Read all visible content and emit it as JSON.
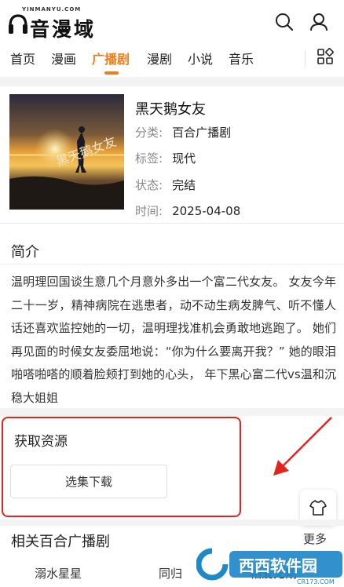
{
  "header": {
    "logo_text": "音漫域",
    "logo_subtitle": "YINMANYU.COM",
    "nav": [
      {
        "label": "首页"
      },
      {
        "label": "漫画"
      },
      {
        "label": "广播剧"
      },
      {
        "label": "漫剧"
      },
      {
        "label": "小说"
      },
      {
        "label": "音乐"
      }
    ],
    "active_index": 2,
    "icons": {
      "search": "search-icon",
      "user": "user-icon",
      "grid": "grid-menu-icon"
    }
  },
  "detail": {
    "title": "黑天鹅女友",
    "cover_text": "黑天鹅女友",
    "meta": [
      {
        "key": "分类:",
        "value": "百合广播剧"
      },
      {
        "key": "标签:",
        "value": "现代"
      },
      {
        "key": "状态:",
        "value": "完结"
      },
      {
        "key": "时间:",
        "value": "2025-04-08"
      }
    ]
  },
  "intro": {
    "heading": "简介",
    "text": "温明理回国谈生意几个月意外多出一个富二代女友。 女友今年二十一岁，精神病院在逃患者，动不动生病发脾气、听不懂人话还喜欢监控她的一切，温明理找准机会勇敢地逃跑了。 她们再见面的时候女友委屈地说：“你为什么要离开我？” 她的眼泪啪嗒啪嗒的顺着脸颊打到她的心头， 年下黑心富二代vs温和沉稳大姐姐"
  },
  "resources": {
    "heading": "获取资源",
    "button_label": "选集下载"
  },
  "related": {
    "heading": "相关百合广播剧",
    "more_label": "更多",
    "items": [
      "溺水星星",
      "同归",
      "相爱无期"
    ]
  },
  "watermark": {
    "text": "西西软件园",
    "sub": "CR173.COM"
  },
  "colors": {
    "accent": "#f07c1a",
    "highlight": "#e2241c"
  }
}
